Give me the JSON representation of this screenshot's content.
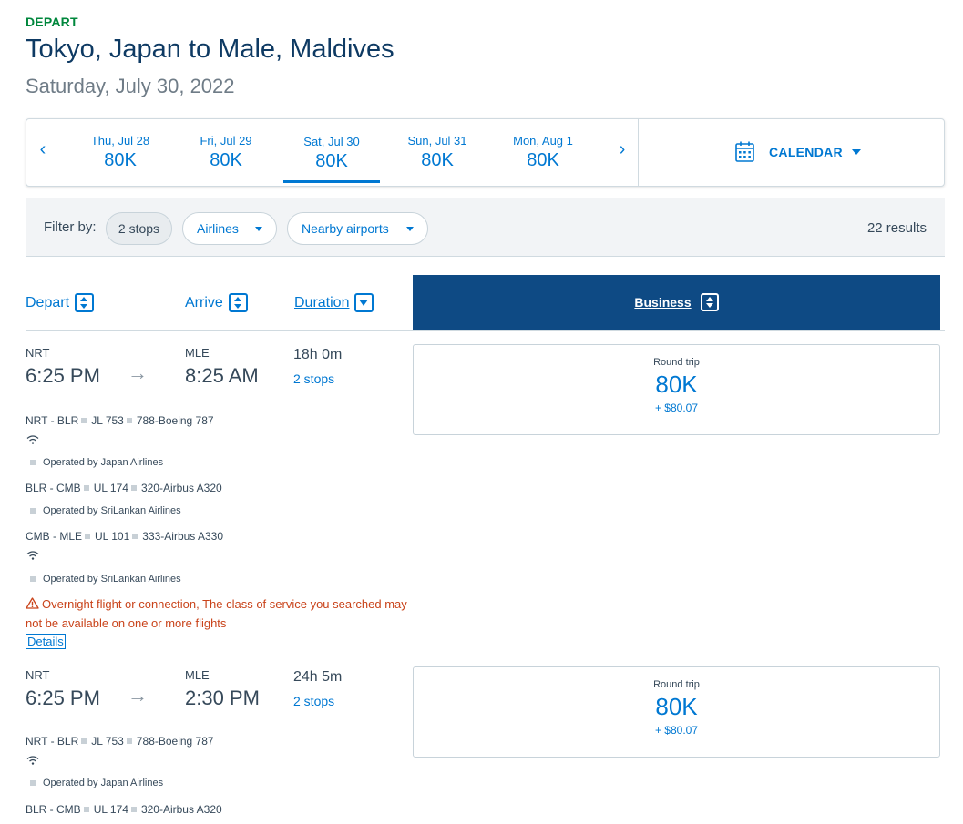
{
  "header": {
    "depart_label": "DEPART",
    "route": "Tokyo, Japan to Male, Maldives",
    "date": "Saturday, July 30, 2022"
  },
  "date_strip": {
    "prev_icon": "‹",
    "next_icon": "›",
    "days": [
      {
        "date": "Thu, Jul 28",
        "price": "80K"
      },
      {
        "date": "Fri, Jul 29",
        "price": "80K"
      },
      {
        "date": "Sat, Jul 30",
        "price": "80K",
        "selected": true
      },
      {
        "date": "Sun, Jul 31",
        "price": "80K"
      },
      {
        "date": "Mon, Aug 1",
        "price": "80K"
      }
    ],
    "calendar_label": "CALENDAR",
    "calendar_icon": "calendar-icon"
  },
  "filters": {
    "label": "Filter by:",
    "stops": "2 stops",
    "airlines": "Airlines",
    "nearby": "Nearby airports",
    "results": "22 results"
  },
  "columns": {
    "depart": "Depart",
    "arrive": "Arrive",
    "duration": "Duration",
    "cabin": "Business"
  },
  "flights": [
    {
      "dep_airport": "NRT",
      "dep_time": "6:25 PM",
      "arr_airport": "MLE",
      "arr_time": "8:25 AM",
      "duration": "18h 0m",
      "stops": "2 stops",
      "segments": [
        {
          "route": "NRT - BLR",
          "flight": "JL 753",
          "aircraft": "788-Boeing 787",
          "wifi": true,
          "operator": "Operated by Japan Airlines"
        },
        {
          "route": "BLR - CMB",
          "flight": "UL 174",
          "aircraft": "320-Airbus A320",
          "wifi": false,
          "operator": "Operated by SriLankan Airlines"
        },
        {
          "route": "CMB - MLE",
          "flight": "UL 101",
          "aircraft": "333-Airbus A330",
          "wifi": true,
          "operator": "Operated by SriLankan Airlines"
        }
      ],
      "warning": "Overnight flight or connection, The class of service you searched may not be available on one or more flights",
      "details": "Details",
      "price": {
        "trip": "Round trip",
        "miles": "80K",
        "tax": "+ $80.07"
      }
    },
    {
      "dep_airport": "NRT",
      "dep_time": "6:25 PM",
      "arr_airport": "MLE",
      "arr_time": "2:30 PM",
      "duration": "24h 5m",
      "stops": "2 stops",
      "segments": [
        {
          "route": "NRT - BLR",
          "flight": "JL 753",
          "aircraft": "788-Boeing 787",
          "wifi": true,
          "operator": "Operated by Japan Airlines"
        },
        {
          "route": "BLR - CMB",
          "flight": "UL 174",
          "aircraft": "320-Airbus A320"
        }
      ],
      "price": {
        "trip": "Round trip",
        "miles": "80K",
        "tax": "+ $80.07"
      }
    }
  ],
  "colors": {
    "accent": "#0078d2",
    "header_dark": "#0e4a84",
    "depart_green": "#00873c",
    "warning": "#c9431a"
  }
}
